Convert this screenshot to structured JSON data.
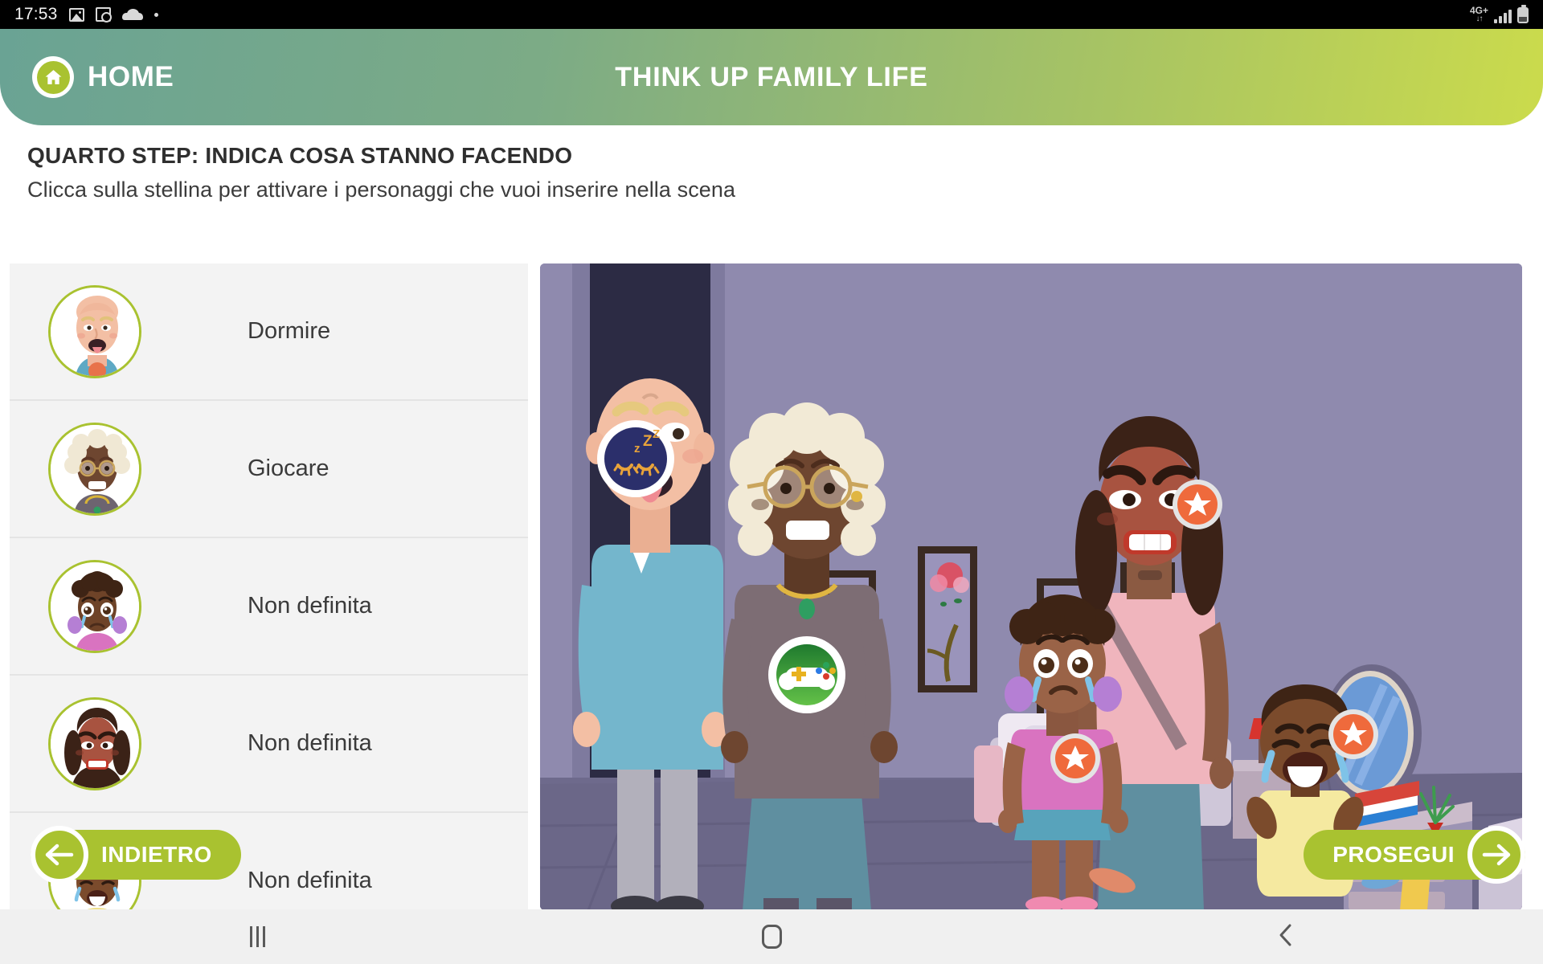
{
  "status_bar": {
    "clock": "17:53",
    "icons": [
      "photo-icon",
      "image-search-icon",
      "cloud-icon",
      "dot-icon"
    ],
    "network": "4G+",
    "network_arrows": "↓↑",
    "signal": "signal-bars-icon",
    "battery": "battery-icon"
  },
  "header": {
    "home_label": "HOME",
    "home_icon": "house-icon",
    "title": "THINK UP FAMILY LIFE",
    "gradient_from": "#6aa394",
    "gradient_to": "#cbdb4c"
  },
  "instructions": {
    "step_title": "QUARTO STEP: INDICA COSA STANNO FACENDO",
    "subtitle": "Clicca sulla stellina per attivare i personaggi che vuoi inserire nella scena"
  },
  "character_list": {
    "items": [
      {
        "label": "Dormire",
        "avatar": "bald-man-tongue-out-avatar"
      },
      {
        "label": "Giocare",
        "avatar": "grandmother-glasses-avatar"
      },
      {
        "label": "Non definita",
        "avatar": "crying-girl-avatar"
      },
      {
        "label": "Non definita",
        "avatar": "angry-woman-avatar"
      },
      {
        "label": "Non definita",
        "avatar": "crying-baby-avatar"
      }
    ]
  },
  "scene": {
    "description": "family-bedroom-scene",
    "badges": [
      {
        "type": "sleep-badge",
        "icon": "sleeping-zzz-icon",
        "color": "#2b2f6b"
      },
      {
        "type": "play-badge",
        "icon": "game-controller-icon",
        "color": "#3f9e2f"
      },
      {
        "type": "star-badge",
        "icon": "star-icon",
        "color": "#ef6a3c"
      },
      {
        "type": "star-badge",
        "icon": "star-icon",
        "color": "#ef6a3c"
      },
      {
        "type": "star-badge",
        "icon": "star-icon",
        "color": "#ef6a3c"
      }
    ]
  },
  "actions": {
    "back_label": "INDIETRO",
    "back_icon": "arrow-left-icon",
    "next_label": "PROSEGUI",
    "next_icon": "arrow-right-icon",
    "accent_color": "#a9c230"
  },
  "android_nav": {
    "recents": "recents-icon",
    "home": "home-square-icon",
    "back": "back-chevron-icon"
  }
}
